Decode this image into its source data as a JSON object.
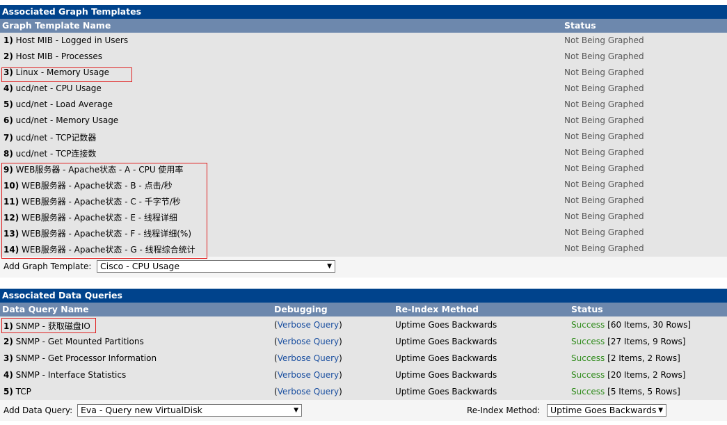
{
  "graph_templates": {
    "title": "Associated Graph Templates",
    "col_name": "Graph Template Name",
    "col_status": "Status",
    "rows": [
      {
        "num": "1)",
        "name": "Host MIB - Logged in Users",
        "status": "Not Being Graphed"
      },
      {
        "num": "2)",
        "name": "Host MIB - Processes",
        "status": "Not Being Graphed"
      },
      {
        "num": "3)",
        "name": "Linux - Memory Usage",
        "status": "Not Being Graphed"
      },
      {
        "num": "4)",
        "name": "ucd/net - CPU Usage",
        "status": "Not Being Graphed"
      },
      {
        "num": "5)",
        "name": "ucd/net - Load Average",
        "status": "Not Being Graphed"
      },
      {
        "num": "6)",
        "name": "ucd/net - Memory Usage",
        "status": "Not Being Graphed"
      },
      {
        "num": "7)",
        "name": "ucd/net - TCP记数器",
        "status": "Not Being Graphed"
      },
      {
        "num": "8)",
        "name": "ucd/net - TCP连接数",
        "status": "Not Being Graphed"
      },
      {
        "num": "9)",
        "name": "WEB服务器 - Apache状态 - A - CPU 使用率",
        "status": "Not Being Graphed"
      },
      {
        "num": "10)",
        "name": "WEB服务器 - Apache状态 - B - 点击/秒",
        "status": "Not Being Graphed"
      },
      {
        "num": "11)",
        "name": "WEB服务器 - Apache状态 - C - 千字节/秒",
        "status": "Not Being Graphed"
      },
      {
        "num": "12)",
        "name": "WEB服务器 - Apache状态 - E - 线程详细",
        "status": "Not Being Graphed"
      },
      {
        "num": "13)",
        "name": "WEB服务器 - Apache状态 - F - 线程详细(%)",
        "status": "Not Being Graphed"
      },
      {
        "num": "14)",
        "name": "WEB服务器 - Apache状态 - G - 线程综合统计",
        "status": "Not Being Graphed"
      }
    ],
    "add_label": "Add Graph Template:",
    "add_value": "Cisco - CPU Usage"
  },
  "data_queries": {
    "title": "Associated Data Queries",
    "col_name": "Data Query Name",
    "col_debug": "Debugging",
    "col_reindex": "Re-Index Method",
    "col_status": "Status",
    "rows": [
      {
        "num": "1)",
        "name": "SNMP - 获取磁盘IO",
        "debug": "Verbose Query",
        "reindex": "Uptime Goes Backwards",
        "status": "Success",
        "detail": "[60 Items, 30 Rows]"
      },
      {
        "num": "2)",
        "name": "SNMP - Get Mounted Partitions",
        "debug": "Verbose Query",
        "reindex": "Uptime Goes Backwards",
        "status": "Success",
        "detail": "[27 Items, 9 Rows]"
      },
      {
        "num": "3)",
        "name": "SNMP - Get Processor Information",
        "debug": "Verbose Query",
        "reindex": "Uptime Goes Backwards",
        "status": "Success",
        "detail": "[2 Items, 2 Rows]"
      },
      {
        "num": "4)",
        "name": "SNMP - Interface Statistics",
        "debug": "Verbose Query",
        "reindex": "Uptime Goes Backwards",
        "status": "Success",
        "detail": "[20 Items, 2 Rows]"
      },
      {
        "num": "5)",
        "name": "TCP",
        "debug": "Verbose Query",
        "reindex": "Uptime Goes Backwards",
        "status": "Success",
        "detail": "[5 Items, 5 Rows]"
      }
    ],
    "add_label": "Add Data Query:",
    "add_value": "Eva - Query new VirtualDisk",
    "reindex_label": "Re-Index Method:",
    "reindex_value": "Uptime Goes Backwards"
  },
  "colors": {
    "title_bar": "#00438c",
    "header_row": "#6d88ad",
    "row_bg": "#e5e5e5",
    "link": "#1a4fa0",
    "success": "#2e8b1a",
    "highlight": "#e02020"
  }
}
